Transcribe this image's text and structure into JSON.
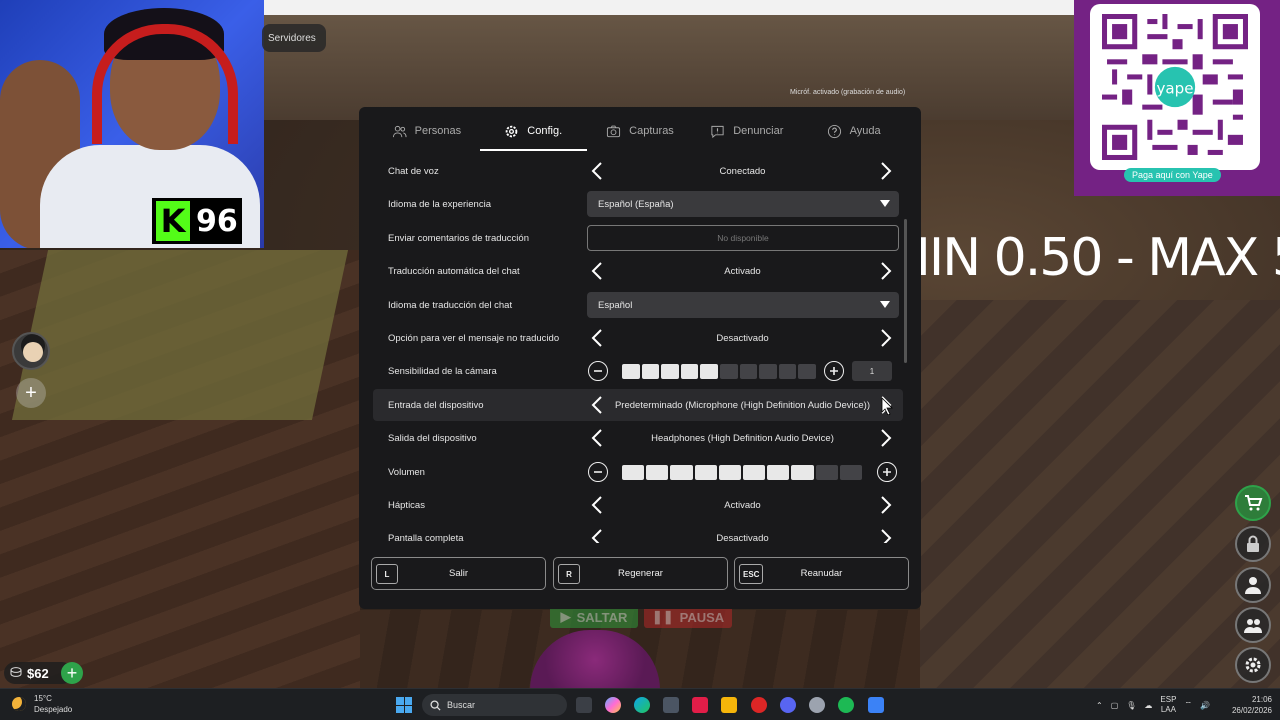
{
  "servers_pill": {
    "label": "Servidores"
  },
  "mic_status": "Micróf. activado (grabación de audio)",
  "stream": {
    "follower_count": "96",
    "kick_letter": "K",
    "overlay_text": "MIN 0.50 - MAX 5",
    "yape_label": "Paga aquí con Yape",
    "yape_brand": "yape"
  },
  "hud": {
    "money": "$62",
    "saltar": "SALTAR",
    "pausa": "PAUSA"
  },
  "settings": {
    "tabs": [
      {
        "label": "Personas",
        "icon": "people-icon",
        "active": false
      },
      {
        "label": "Config.",
        "icon": "gear-icon",
        "active": true
      },
      {
        "label": "Capturas",
        "icon": "camera-icon",
        "active": false
      },
      {
        "label": "Denunciar",
        "icon": "report-icon",
        "active": false
      },
      {
        "label": "Ayuda",
        "icon": "help-icon",
        "active": false
      }
    ],
    "rows": [
      {
        "label": "Chat de voz",
        "type": "selector",
        "value": "Conectado"
      },
      {
        "label": "Idioma de la experiencia",
        "type": "dropdown",
        "value": "Español (España)"
      },
      {
        "label": "Enviar comentarios de traducción",
        "type": "disabled",
        "value": "No disponible"
      },
      {
        "label": "Traducción automática del chat",
        "type": "selector",
        "value": "Activado"
      },
      {
        "label": "Idioma de traducción del chat",
        "type": "dropdown",
        "value": "Español"
      },
      {
        "label": "Opción para ver el mensaje no traducido",
        "type": "selector",
        "value": "Desactivado"
      },
      {
        "label": "Sensibilidad de la cámara",
        "type": "slider",
        "level": 5,
        "max": 10,
        "value": "1"
      },
      {
        "label": "Entrada del dispositivo",
        "type": "selector",
        "value": "Predeterminado (Microphone (High Definition Audio Device))"
      },
      {
        "label": "Salida del dispositivo",
        "type": "selector",
        "value": "Headphones (High Definition Audio Device)"
      },
      {
        "label": "Volumen",
        "type": "slider",
        "level": 8,
        "max": 10
      },
      {
        "label": "Hápticas",
        "type": "selector",
        "value": "Activado"
      },
      {
        "label": "Pantalla completa",
        "type": "selector",
        "value": "Desactivado"
      }
    ],
    "buttons": [
      {
        "key": "L",
        "label": "Salir"
      },
      {
        "key": "R",
        "label": "Regenerar"
      },
      {
        "key": "ESC",
        "label": "Reanudar"
      }
    ]
  },
  "taskbar": {
    "temperature": "15°C",
    "weather": "Despejado",
    "search_placeholder": "Buscar",
    "lang_top": "ESP",
    "lang_bottom": "LAA",
    "time": "21:06",
    "date": "26/02/2026"
  }
}
